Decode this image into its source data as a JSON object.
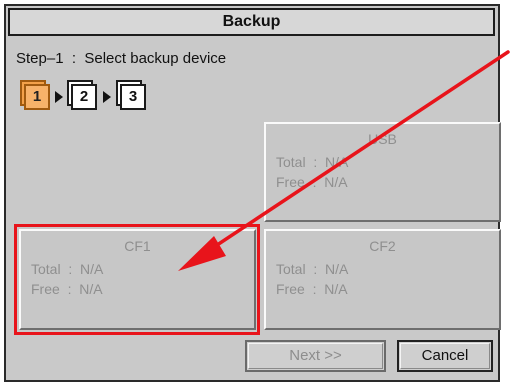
{
  "window": {
    "title": "Backup"
  },
  "step": {
    "text": "Step–1  :  Select backup device"
  },
  "steps": [
    {
      "label": "1",
      "active": true
    },
    {
      "label": "2",
      "active": false
    },
    {
      "label": "3",
      "active": false
    }
  ],
  "devices": {
    "usb": {
      "name": "USB",
      "total": "Total  :  N/A",
      "free": "Free  :  N/A"
    },
    "cf1": {
      "name": "CF1",
      "total": "Total  :  N/A",
      "free": "Free  :  N/A"
    },
    "cf2": {
      "name": "CF2",
      "total": "Total  :  N/A",
      "free": "Free  :  N/A"
    }
  },
  "buttons": {
    "next": "Next  >>",
    "cancel": "Cancel"
  },
  "colors": {
    "annotation": "#e8141b",
    "active_step": "#f3a14a",
    "panel": "#c9c9c9"
  },
  "selected_device": "cf1"
}
